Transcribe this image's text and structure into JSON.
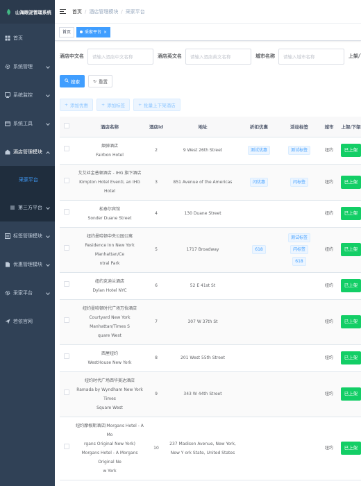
{
  "app": {
    "title": "山海眼泥管理系统"
  },
  "sidebar": {
    "items": [
      {
        "label": "首页",
        "icon": "dashboard-icon"
      },
      {
        "label": "系统管理",
        "icon": "gear-icon"
      },
      {
        "label": "系统监控",
        "icon": "monitor-icon"
      },
      {
        "label": "系统工具",
        "icon": "tool-icon"
      },
      {
        "label": "酒店管理模块",
        "icon": "hotel-icon"
      },
      {
        "label": "标签管理模块",
        "icon": "tag-icon"
      },
      {
        "label": "优惠管理模块",
        "icon": "coupon-icon"
      },
      {
        "label": "采家平台",
        "icon": "gear-icon"
      },
      {
        "label": "若依官网",
        "icon": "send-icon"
      }
    ],
    "sub_items": [
      {
        "label": "采家平台"
      },
      {
        "label": "第三方平台"
      }
    ]
  },
  "navbar": {
    "breadcrumb": [
      "首页",
      "酒店管理模块",
      "采家平台"
    ]
  },
  "tags": [
    {
      "label": "首页"
    },
    {
      "label": "采家平台"
    }
  ],
  "search": {
    "fields": [
      {
        "label": "酒店中文名",
        "placeholder": "请输入酒店中文名称"
      },
      {
        "label": "酒店英文名",
        "placeholder": "请输入酒店英文名称"
      },
      {
        "label": "城市名称",
        "placeholder": "请输入城市名称"
      },
      {
        "label": "上架/下架",
        "placeholder": ""
      }
    ],
    "search_label": "搜索",
    "reset_label": "重置"
  },
  "actions": {
    "add_coupon": "添加优惠",
    "add_tag": "添加标签",
    "batch": "批量上下架酒店"
  },
  "table": {
    "headers": [
      "",
      "酒店名称",
      "酒店id",
      "地址",
      "折扣优惠",
      "活动标签",
      "城市",
      "上架/下架"
    ],
    "rows": [
      {
        "name": [
          "烟弹酒店",
          "Fairbon Hotel"
        ],
        "id": "2",
        "address": "9 West 26th Street",
        "discount": [
          "测试优惠"
        ],
        "tags": [
          "测试标签"
        ],
        "city": "纽约",
        "status": "已上架"
      },
      {
        "name": [
          "艾艾丝金普顿酒店 - IHG 旗下酒店",
          "Kimpton Hotel Eventi, an IHG Hotel"
        ],
        "id": "3",
        "address": "851 Avenue of the Americas",
        "discount": [
          "闪优惠"
        ],
        "tags": [
          "闪标签"
        ],
        "city": "纽约",
        "status": "已上架"
      },
      {
        "name": [
          "松泰尔宾馆",
          "Sonder Duane Street"
        ],
        "id": "4",
        "address": "130 Duane Street",
        "discount": [],
        "tags": [],
        "city": "纽约",
        "status": "已上架"
      },
      {
        "name": [
          "纽约曼哈顿中央公园公寓",
          "Residence Inn New York Manhattan/Ce",
          "ntral Park"
        ],
        "id": "5",
        "address": "1717 Broadway",
        "discount": [
          "618"
        ],
        "tags": [
          "测试标签",
          "闪标签",
          "618"
        ],
        "city": "纽约",
        "status": "已上架"
      },
      {
        "name": [
          "纽约克迪兰酒店",
          "Dylan Hotel NYC"
        ],
        "id": "6",
        "address": "52 E 41st St",
        "discount": [],
        "tags": [],
        "city": "纽约",
        "status": "已上架"
      },
      {
        "name": [
          "纽约曼哈顿时代广场万怡酒店",
          "Courtyard New York Manhattan/Times S",
          "quare West"
        ],
        "id": "7",
        "address": "307 W 37th St",
        "discount": [],
        "tags": [],
        "city": "纽约",
        "status": "已上架"
      },
      {
        "name": [
          "西屋纽约",
          "WestHouse New York"
        ],
        "id": "8",
        "address": "201 West 55th Street",
        "discount": [],
        "tags": [],
        "city": "纽约",
        "status": "已上架"
      },
      {
        "name": [
          "纽约时代广场西华美达酒店",
          "Ramada by Wyndham New York Times",
          "Square West"
        ],
        "id": "9",
        "address": "343 W 44th Street",
        "discount": [],
        "tags": [],
        "city": "纽约",
        "status": "已上架"
      },
      {
        "name": [
          "纽约摩根斯酒店(Morgans Hotel - A Mo",
          "rgans Original New York)",
          "Morgans Hotel - A Morgans Original Ne",
          "w York"
        ],
        "id": "10",
        "address": "237 Madison Avenue, New York, New Y ork State, United States",
        "discount": [],
        "tags": [],
        "city": "纽约",
        "status": "已上架"
      }
    ]
  },
  "colors": {
    "sidebar": "#304156",
    "primary": "#409eff",
    "success": "#13ce66"
  }
}
